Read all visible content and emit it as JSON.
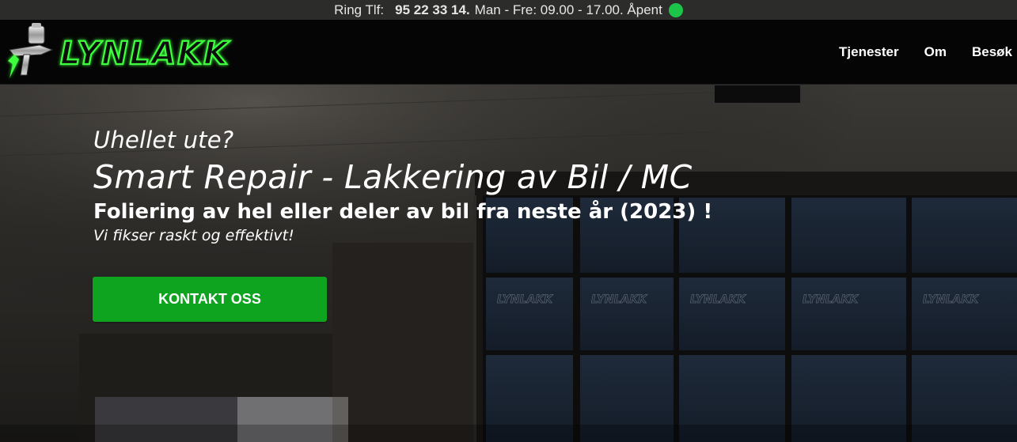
{
  "topbar": {
    "phone_label": "Ring Tlf:",
    "phone_number": "95 22 33 14.",
    "hours": "Man - Fre: 09.00 - 17.00. Åpent",
    "status_color": "#1cc44a"
  },
  "header": {
    "logo_text": "LYNLAKK",
    "nav": [
      {
        "label": "Tjenester"
      },
      {
        "label": "Om"
      },
      {
        "label": "Besøk"
      }
    ]
  },
  "hero": {
    "kicker": "Uhellet ute?",
    "headline": "Smart Repair - Lakkering av Bil / MC",
    "subheadline": "Foliering av hel eller deler av bil fra neste år (2023) !",
    "tagline": "Vi fikser raskt og effektivt!",
    "cta_label": "KONTAKT OSS",
    "window_logo_text": "LYNLAKK"
  },
  "colors": {
    "accent": "#0fa41f",
    "logo_glow": "#3cff3c",
    "topbar_bg": "#2c2d2b",
    "header_bg": "#050505"
  }
}
